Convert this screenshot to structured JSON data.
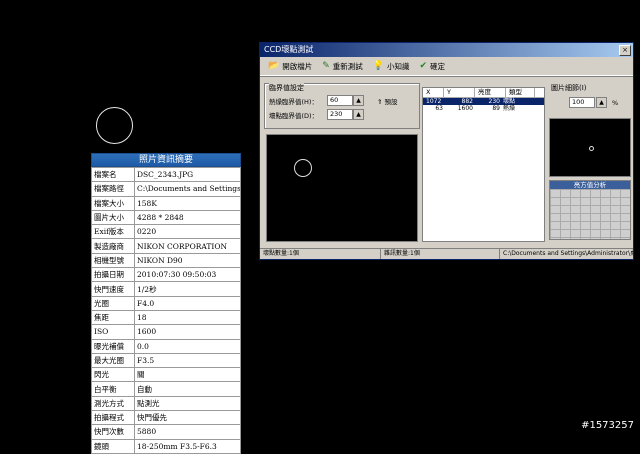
{
  "info": {
    "title": "照片資訊摘要",
    "rows": [
      {
        "k": "檔案名",
        "v": "DSC_2343.JPG"
      },
      {
        "k": "檔案路徑",
        "v": "C:\\Documents and Settings\\Adm"
      },
      {
        "k": "檔案大小",
        "v": "158K"
      },
      {
        "k": "圖片大小",
        "v": "4288 * 2848"
      },
      {
        "k": "Exif版本",
        "v": "0220"
      },
      {
        "k": "製造廠商",
        "v": "NIKON CORPORATION"
      },
      {
        "k": "相機型號",
        "v": "NIKON D90"
      },
      {
        "k": "拍攝日期",
        "v": "2010:07:30 09:50:03"
      },
      {
        "k": "快門速度",
        "v": "1/2秒"
      },
      {
        "k": "光圈",
        "v": "F4.0"
      },
      {
        "k": "焦距",
        "v": "18"
      },
      {
        "k": "ISO",
        "v": "1600"
      },
      {
        "k": "曝光補償",
        "v": "0.0"
      },
      {
        "k": "最大光圈",
        "v": "F3.5"
      },
      {
        "k": "閃光",
        "v": "關"
      },
      {
        "k": "白平衡",
        "v": "自動"
      },
      {
        "k": "測光方式",
        "v": "點測光"
      },
      {
        "k": "拍攝程式",
        "v": "快門優先"
      },
      {
        "k": "快門次數",
        "v": "5880"
      },
      {
        "k": "鏡頭",
        "v": "18-250mm F3.5-F6.3"
      }
    ]
  },
  "dialog": {
    "title": "CCD壞點測試",
    "close": "×",
    "toolbar": [
      {
        "label": "開啟檔片",
        "icon": "📂"
      },
      {
        "label": "重新測試",
        "icon": "✎"
      },
      {
        "label": "小知識",
        "icon": "💡"
      },
      {
        "label": "確定",
        "icon": "✔"
      }
    ],
    "threshold": {
      "group_label": "臨界值設定",
      "hot_label": "熱燥臨界值(H)：",
      "hot_value": "60",
      "dead_label": "壞點臨界值(D)：",
      "dead_value": "230",
      "preset_label": "預設"
    },
    "list": {
      "headers": [
        "X",
        "Y",
        "亮度",
        "類型"
      ],
      "rows": [
        {
          "x": "1072",
          "y": "882",
          "b": "230",
          "t": "壞點"
        },
        {
          "x": "63",
          "y": "1600",
          "b": "89",
          "t": "熱燥"
        }
      ]
    },
    "detail": {
      "label": "圖片細節(I)",
      "zoom_value": "100",
      "zoom_unit": "%"
    },
    "hist_title": "亮方值分析",
    "status": {
      "dead_count": "壞點數量:1個",
      "hot_count": "雜訊數量:1個",
      "path": "C:\\Documents and Settings\\Administrator\\桌面\\DSC_2343.JPG"
    }
  },
  "watermark": "#1573257"
}
